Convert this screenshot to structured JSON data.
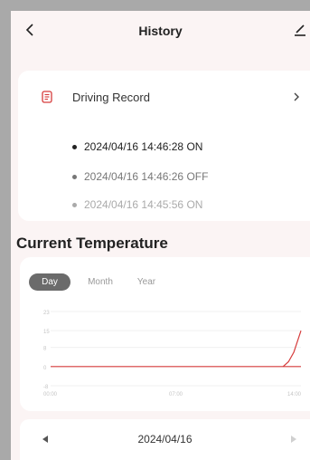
{
  "header": {
    "title": "History"
  },
  "record": {
    "label": "Driving Record",
    "entries": [
      {
        "text": "2024/04/16 14:46:28 ON",
        "color": "#222222"
      },
      {
        "text": "2024/04/16 14:46:26 OFF",
        "color": "#777777"
      },
      {
        "text": "2024/04/16 14:45:56 ON",
        "color": "#aaaaaa"
      }
    ]
  },
  "temperature": {
    "title": "Current Temperature",
    "tabs": {
      "day": "Day",
      "month": "Month",
      "year": "Year"
    }
  },
  "chart_data": {
    "type": "line",
    "y_ticks": [
      "23",
      "15",
      "8",
      "0",
      "-8"
    ],
    "y_values": [
      23,
      15,
      8,
      0,
      -8
    ],
    "x_ticks": [
      "00:00",
      "07:00",
      "14:00"
    ],
    "x_values": [
      0,
      7,
      14
    ],
    "xlim": [
      0,
      14
    ],
    "ylim": [
      -8,
      23
    ],
    "grid": true,
    "line_color": "#d63c3c",
    "series": [
      {
        "x": [
          0,
          12,
          13,
          14
        ],
        "y": [
          0,
          0,
          0,
          0
        ]
      },
      {
        "x": [
          13.0,
          13.3,
          13.6,
          14.0
        ],
        "y": [
          0,
          2,
          6,
          15
        ]
      }
    ]
  },
  "date_nav": {
    "date": "2024/04/16"
  },
  "colors": {
    "accent": "#d63c3c",
    "card": "#ffffff",
    "background": "#fbf4f4"
  }
}
